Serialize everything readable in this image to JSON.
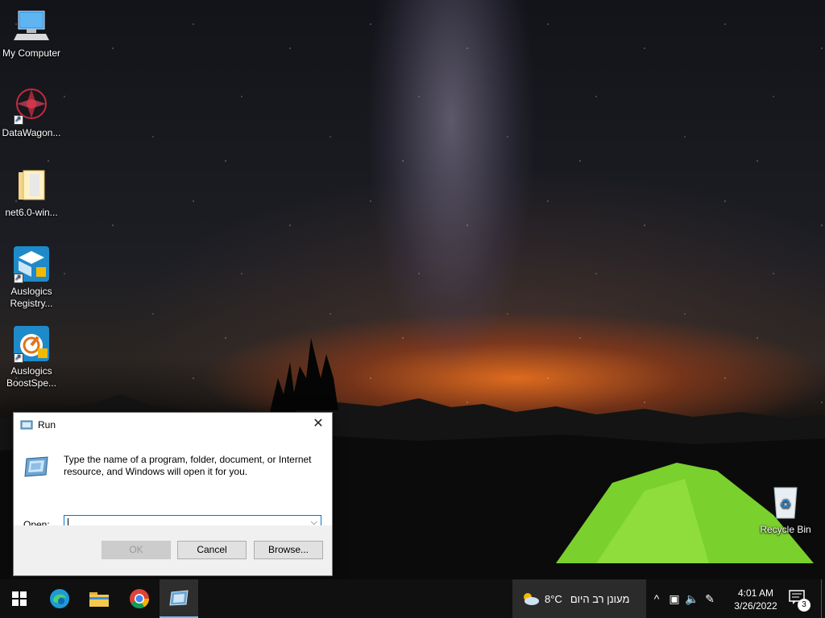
{
  "desktop": {
    "icons": [
      {
        "label": "My Computer",
        "icon": "computer-icon"
      },
      {
        "label": "DataWagon...",
        "icon": "datawagon-icon"
      },
      {
        "label": "net6.0-win...",
        "icon": "folder-icon"
      },
      {
        "label": "Auslogics Registry...",
        "icon": "auslogics-registry-icon"
      },
      {
        "label": "Auslogics BoostSpe...",
        "icon": "auslogics-boostspeed-icon"
      },
      {
        "label": "Recycle Bin",
        "icon": "recycle-bin-icon"
      }
    ]
  },
  "run_dialog": {
    "title": "Run",
    "description": "Type the name of a program, folder, document, or Internet resource, and Windows will open it for you.",
    "open_label": "Open:",
    "open_value": "",
    "ok_label": "OK",
    "cancel_label": "Cancel",
    "browse_label": "Browse...",
    "close_glyph": "✕"
  },
  "taskbar": {
    "apps": [
      "start-icon",
      "edge-icon",
      "file-explorer-icon",
      "chrome-icon",
      "run-icon"
    ],
    "weather": {
      "temperature": "8°C",
      "condition": "מעונן רב היום"
    },
    "clock": {
      "time": "4:01 AM",
      "date": "3/26/2022"
    },
    "notifications_count": "3"
  },
  "colors": {
    "accent": "#0078d7",
    "taskbar": "#101010",
    "tent": "#7ad02c"
  }
}
